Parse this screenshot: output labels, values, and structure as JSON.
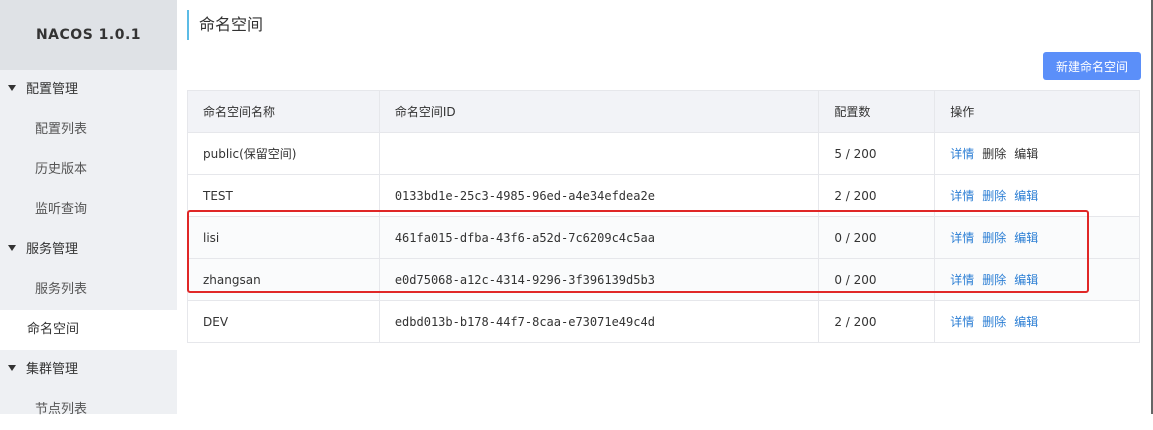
{
  "app": {
    "logo": "NACOS 1.0.1"
  },
  "sidebar": {
    "groups": [
      {
        "label": "配置管理",
        "items": [
          "配置列表",
          "历史版本",
          "监听查询"
        ]
      },
      {
        "label": "服务管理",
        "items": [
          "服务列表"
        ]
      },
      {
        "label": "集群管理",
        "items": [
          "节点列表"
        ]
      }
    ],
    "standalone": "命名空间"
  },
  "page": {
    "title": "命名空间",
    "new_button": "新建命名空间"
  },
  "table": {
    "headers": [
      "命名空间名称",
      "命名空间ID",
      "配置数",
      "操作"
    ],
    "rows": [
      {
        "name": "public(保留空间)",
        "id": "",
        "count": "5 / 200"
      },
      {
        "name": "TEST",
        "id": "0133bd1e-25c3-4985-96ed-a4e34efdea2e",
        "count": "2 / 200"
      },
      {
        "name": "lisi",
        "id": "461fa015-dfba-43f6-a52d-7c6209c4c5aa",
        "count": "0 / 200"
      },
      {
        "name": "zhangsan",
        "id": "e0d75068-a12c-4314-9296-3f396139d5b3",
        "count": "0 / 200"
      },
      {
        "name": "DEV",
        "id": "edbd013b-b178-44f7-8caa-e73071e49c4d",
        "count": "2 / 200"
      }
    ],
    "actions": [
      "详情",
      "删除",
      "编辑"
    ]
  },
  "colors": {
    "accent": "#5b8ff9",
    "link": "#2b7ed4",
    "highlight": "#e02727"
  }
}
